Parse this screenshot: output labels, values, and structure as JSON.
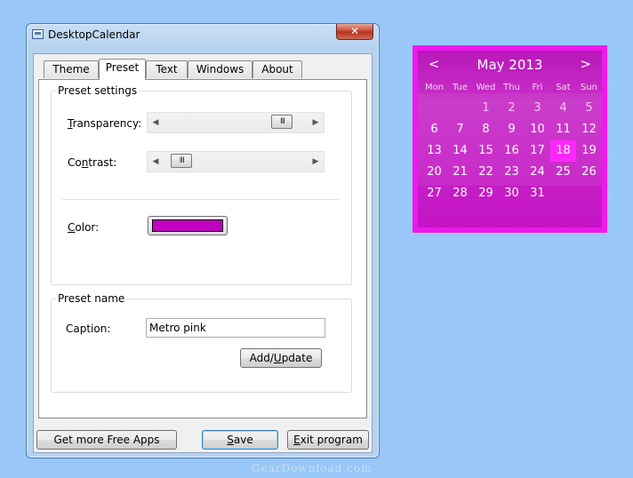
{
  "window": {
    "title": "DesktopCalendar",
    "close_label": "✕"
  },
  "tabs": [
    {
      "label": "Theme"
    },
    {
      "label": "Preset"
    },
    {
      "label": "Text"
    },
    {
      "label": "Windows"
    },
    {
      "label": "About"
    }
  ],
  "preset_settings": {
    "group_title": "Preset settings",
    "transparency_label": "Transparency:",
    "transparency_access_key": "T",
    "transparency_rest": "ransparency:",
    "transparency_level": 0.88,
    "contrast_prefix": "Co",
    "contrast_access_key": "n",
    "contrast_rest": "trast:",
    "contrast_level": 0.06,
    "color_access_key": "C",
    "color_rest": "olor:",
    "color_value": "#c000c0"
  },
  "preset_name": {
    "group_title": "Preset name",
    "caption_label": "Caption:",
    "caption_value": "Metro pink",
    "add_update_prefix": "Add/",
    "add_update_access_key": "U",
    "add_update_rest": "pdate"
  },
  "footer": {
    "get_apps_label": "Get more Free Apps",
    "save_access_key": "S",
    "save_rest": "ave",
    "exit_access_key": "E",
    "exit_rest": "xit program"
  },
  "calendar": {
    "prev_label": "<",
    "next_label": ">",
    "month_label": "May 2013",
    "weekdays": [
      "Mon",
      "Tue",
      "Wed",
      "Thu",
      "Fri",
      "Sat",
      "Sun"
    ],
    "weeks": [
      [
        "",
        "",
        "1",
        "2",
        "3",
        "4",
        "5"
      ],
      [
        "6",
        "7",
        "8",
        "9",
        "10",
        "11",
        "12"
      ],
      [
        "13",
        "14",
        "15",
        "16",
        "17",
        "18",
        "19"
      ],
      [
        "20",
        "21",
        "22",
        "23",
        "24",
        "25",
        "26"
      ],
      [
        "27",
        "28",
        "29",
        "30",
        "31",
        "",
        ""
      ]
    ],
    "today": "18",
    "accent_color": "#ee19ee",
    "today_color": "#ff27ff"
  },
  "watermark": "GearDownload.com"
}
